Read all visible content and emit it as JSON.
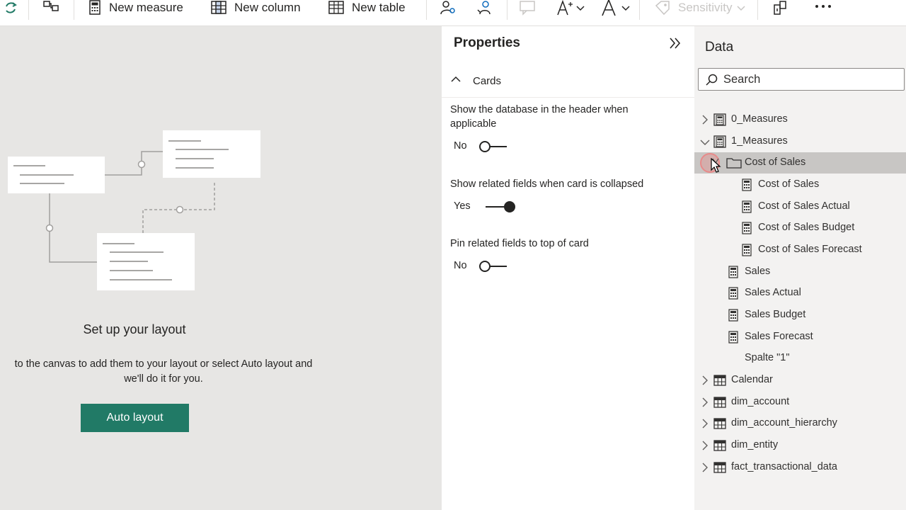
{
  "toolbar": {
    "new_measure": "New measure",
    "new_column": "New column",
    "new_table": "New table",
    "sensitivity": "Sensitivity"
  },
  "canvas": {
    "title": "Set up your layout",
    "description_line1": "to the canvas to add them to your layout or select Auto layout and",
    "description_line2": "we'll do it for you.",
    "auto_layout_button": "Auto layout"
  },
  "properties": {
    "title": "Properties",
    "section": "Cards",
    "options": [
      {
        "label": "Show the database in the header when applicable",
        "state": "No",
        "on": false
      },
      {
        "label": "Show related fields when card is collapsed",
        "state": "Yes",
        "on": true
      },
      {
        "label": "Pin related fields to top of card",
        "state": "No",
        "on": false
      }
    ]
  },
  "data_pane": {
    "title": "Data",
    "search_placeholder": "Search",
    "tree": [
      {
        "label": "0_Measures",
        "icon": "calculator-table-icon",
        "expand": "collapsed"
      },
      {
        "label": "1_Measures",
        "icon": "calculator-table-icon",
        "expand": "expanded"
      },
      {
        "label": "Cost of Sales",
        "icon": "folder-icon",
        "expand": "expanded",
        "selected": true
      },
      {
        "label": "Cost of Sales",
        "icon": "measure-icon",
        "expand": "none"
      },
      {
        "label": "Cost of Sales Actual",
        "icon": "measure-icon",
        "expand": "none"
      },
      {
        "label": "Cost of Sales Budget",
        "icon": "measure-icon",
        "expand": "none"
      },
      {
        "label": "Cost of Sales Forecast",
        "icon": "measure-icon",
        "expand": "none"
      },
      {
        "label": "Sales",
        "icon": "measure-icon",
        "expand": "none"
      },
      {
        "label": "Sales Actual",
        "icon": "measure-icon",
        "expand": "none"
      },
      {
        "label": "Sales Budget",
        "icon": "measure-icon",
        "expand": "none"
      },
      {
        "label": "Sales Forecast",
        "icon": "measure-icon",
        "expand": "none"
      },
      {
        "label": "Spalte \"1\"",
        "icon": "none",
        "expand": "none"
      },
      {
        "label": "Calendar",
        "icon": "table-icon",
        "expand": "collapsed"
      },
      {
        "label": "dim_account",
        "icon": "table-icon",
        "expand": "collapsed"
      },
      {
        "label": "dim_account_hierarchy",
        "icon": "table-icon",
        "expand": "collapsed"
      },
      {
        "label": "dim_entity",
        "icon": "table-icon",
        "expand": "collapsed"
      },
      {
        "label": "fact_transactional_data",
        "icon": "table-icon",
        "expand": "collapsed"
      }
    ]
  },
  "colors": {
    "accent": "#217a66",
    "canvas_bg": "#e7e6e4",
    "data_pane_bg": "#f3f2f1",
    "selected_row": "#c8c6c4"
  }
}
